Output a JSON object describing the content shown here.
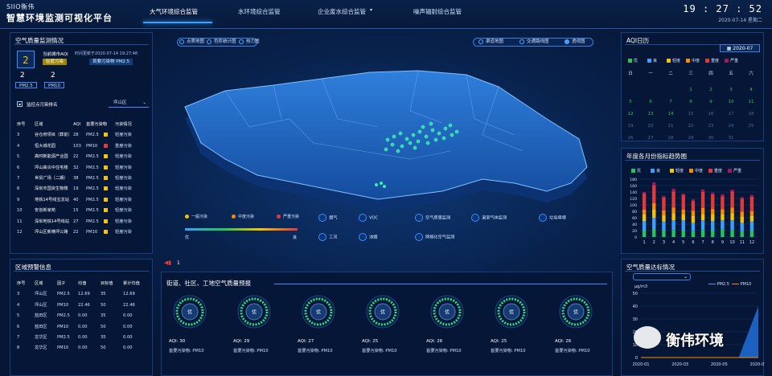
{
  "header": {
    "logo": "SIIO衡伟",
    "title": "智慧环境监测可视化平台",
    "tabs": [
      "大气环境综合监管",
      "水环境综合监管",
      "企业废水综合监管",
      "噪声辐射综合监管"
    ],
    "time": "19 : 27 : 52",
    "date": "2020-07-14 星期二"
  },
  "airquality": {
    "title": "空气质量监测情况",
    "aqi": "2",
    "city_label": "当前城市AQI",
    "level": "轻度污染",
    "update": "时间更新于2020-07-14 19:27:48",
    "primary": "首要污染物 PM2.5",
    "pm25_val": "2",
    "pm25_label": "PM2.5",
    "pm10_val": "2",
    "pm10_label": "PM10"
  },
  "ranking": {
    "title": "监控点污染排名",
    "district": "坪山区",
    "headers": [
      "序号",
      "区域",
      "AQI",
      "首要污染物",
      "污染情况"
    ],
    "rows": [
      [
        "3",
        "谷仓府项目（葬前）",
        "28",
        "PM2.5",
        "轻度污染",
        "#f5c400"
      ],
      [
        "4",
        "恒大城花园",
        "103",
        "PM10",
        "重度污染",
        "#e53939"
      ],
      [
        "5",
        "高时新能源产业园",
        "22",
        "PM2.5",
        "轻度污染",
        "#f5c400"
      ],
      [
        "6",
        "坪山高炎中住宅楼",
        "32",
        "PM2.5",
        "轻度污染",
        "#f5c400"
      ],
      [
        "7",
        "世贸广场（二期）",
        "38",
        "PM2.5",
        "轻度污染",
        "#f5c400"
      ],
      [
        "8",
        "深圳市国资生物楼",
        "19",
        "PM2.5",
        "轻度污染",
        "#f5c400"
      ],
      [
        "9",
        "地铁14号线宝龙站",
        "40",
        "PM2.5",
        "轻度污染",
        "#f5c400"
      ],
      [
        "10",
        "安创新家苑",
        "15",
        "PM2.5",
        "轻度污染",
        "#f5c400"
      ],
      [
        "11",
        "深圳地铁14号线站",
        "27",
        "PM2.5",
        "轻度污染",
        "#f5c400"
      ],
      [
        "12",
        "坪山区新横坪公路",
        "22",
        "PM10",
        "轻度污染",
        "#f5c400"
      ]
    ]
  },
  "warning": {
    "title": "区域预警信息",
    "headers": [
      "序号",
      "区域",
      "因子",
      "均值",
      "目标值",
      "累计均值"
    ],
    "rows": [
      [
        "3",
        "坪山区",
        "PM2.5",
        "12.69",
        "35",
        "12.69"
      ],
      [
        "4",
        "坪山区",
        "PM10",
        "22.46",
        "50",
        "22.46"
      ],
      [
        "5",
        "盐田区",
        "PM2.5",
        "0.00",
        "35",
        "0.00"
      ],
      [
        "6",
        "盐田区",
        "PM10",
        "0.00",
        "50",
        "0.00"
      ],
      [
        "7",
        "龙华区",
        "PM2.5",
        "0.00",
        "35",
        "0.00"
      ],
      [
        "8",
        "龙华区",
        "PM10",
        "0.00",
        "50",
        "0.00"
      ]
    ]
  },
  "map": {
    "layers": [
      "点质地图",
      "色阶统计图",
      "热力图"
    ],
    "modes": [
      "渠道地图",
      "交通路线图",
      "透视图"
    ],
    "legend": [
      "一般污染",
      "中度污染",
      "严重污染"
    ],
    "legend_colors": [
      "#f5c400",
      "#ff8a00",
      "#e53939"
    ],
    "scale_low": "优",
    "scale_high": "良",
    "categories": [
      "烟气",
      "VOC",
      "空气质量监测",
      "温室气体监测",
      "垃圾填埋",
      "工况",
      "油烟",
      "网格化空气监测"
    ]
  },
  "notice": {
    "text": "1"
  },
  "forecast": {
    "title": "街道、社区、工地空气质量预报",
    "level": "优",
    "items": [
      [
        "AQI: 30",
        "首要污染物: PM10"
      ],
      [
        "AQI: 29",
        "首要污染物: PM10"
      ],
      [
        "AQI: 27",
        "首要污染物: PM10"
      ],
      [
        "AQI: 25",
        "首要污染物: PM10"
      ],
      [
        "AQI: 26",
        "首要污染物: PM10"
      ],
      [
        "AQI: 25",
        "首要污染物: PM10"
      ],
      [
        "AQI: 26",
        "首要污染物: PM10"
      ]
    ]
  },
  "calendar": {
    "title": "AQI日历",
    "month": "2020-07",
    "legend": [
      "优",
      "良",
      "轻度",
      "中度",
      "重度",
      "严重"
    ],
    "legend_colors": [
      "#23c65a",
      "#3aa0ff",
      "#f5c400",
      "#ff8a00",
      "#e53939",
      "#a0195a"
    ],
    "weekdays": [
      "日",
      "一",
      "二",
      "三",
      "四",
      "五",
      "六"
    ],
    "days": [
      "",
      "",
      "",
      "1",
      "2",
      "3",
      "4",
      "5",
      "6",
      "7",
      "8",
      "9",
      "10",
      "11",
      "12",
      "13",
      "14",
      "15",
      "16",
      "17",
      "18",
      "19",
      "20",
      "21",
      "22",
      "23",
      "24",
      "25",
      "26",
      "27",
      "28",
      "29",
      "30",
      "31"
    ]
  },
  "monthly": {
    "title": "年度各月份指标趋势图",
    "legend": [
      "优",
      "良",
      "轻度",
      "中度",
      "重度",
      "严重"
    ]
  },
  "standard": {
    "title": "空气质量达标情况",
    "unit": "μg/m3",
    "legend": [
      "PM2.5",
      "PM10"
    ],
    "yticks": [
      "50",
      "40",
      "30",
      "20",
      "10",
      "0"
    ],
    "xticks": [
      "2020-01",
      "2020-03",
      "2020-05",
      "2020-07"
    ]
  },
  "watermark": "衡伟环境",
  "chart_data": [
    {
      "type": "bar",
      "title": "年度各月份指标趋势图",
      "categories": [
        "1",
        "2",
        "3",
        "4",
        "5",
        "6",
        "7",
        "8",
        "9",
        "10",
        "11",
        "12"
      ],
      "ylim": [
        0,
        180
      ],
      "yticks": [
        0,
        20,
        40,
        60,
        80,
        100,
        120,
        140,
        160,
        180
      ],
      "series": [
        {
          "name": "优",
          "values": [
            20,
            25,
            20,
            22,
            20,
            18,
            22,
            20,
            24,
            22,
            18,
            20
          ]
        },
        {
          "name": "良",
          "values": [
            30,
            35,
            28,
            30,
            32,
            26,
            30,
            30,
            28,
            30,
            26,
            28
          ]
        },
        {
          "name": "轻度",
          "values": [
            20,
            25,
            20,
            22,
            18,
            22,
            20,
            22,
            20,
            22,
            20,
            18
          ]
        },
        {
          "name": "中度",
          "values": [
            15,
            20,
            15,
            18,
            15,
            16,
            18,
            16,
            15,
            18,
            15,
            14
          ]
        },
        {
          "name": "重度",
          "values": [
            50,
            55,
            40,
            50,
            45,
            30,
            50,
            45,
            40,
            50,
            40,
            45
          ]
        },
        {
          "name": "严重",
          "values": [
            5,
            10,
            5,
            8,
            5,
            5,
            8,
            5,
            6,
            5,
            5,
            6
          ]
        }
      ]
    },
    {
      "type": "area",
      "title": "空气质量达标情况",
      "ylabel": "μg/m3",
      "ylim": [
        0,
        50
      ],
      "x": [
        "2020-01",
        "2020-02",
        "2020-03",
        "2020-04",
        "2020-05",
        "2020-06",
        "2020-07"
      ],
      "series": [
        {
          "name": "PM2.5",
          "values": [
            0,
            0,
            0,
            0,
            0,
            0,
            40
          ]
        },
        {
          "name": "PM10",
          "values": [
            0,
            0,
            0,
            0,
            0,
            0,
            0
          ]
        }
      ]
    }
  ]
}
